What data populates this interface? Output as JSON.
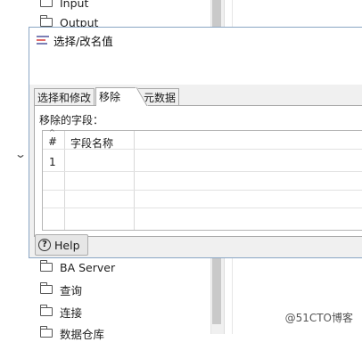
{
  "tree": {
    "items": [
      {
        "label": "Input"
      },
      {
        "label": "Output"
      },
      {
        "label": "BA Server"
      },
      {
        "label": "查询"
      },
      {
        "label": "连接"
      },
      {
        "label": "数据仓库"
      }
    ]
  },
  "dialog": {
    "title": "选择/改名值",
    "tabs": [
      {
        "label": "选择和修改"
      },
      {
        "label": "移除"
      },
      {
        "label": "元数据"
      }
    ],
    "active_tab": "移除",
    "group_label": "移除的字段：",
    "table": {
      "columns": [
        "#",
        "字段名称"
      ],
      "rows": [
        {
          "num": "1",
          "field": ""
        }
      ]
    },
    "help_label": "Help"
  },
  "watermark": "@51CTO博客"
}
